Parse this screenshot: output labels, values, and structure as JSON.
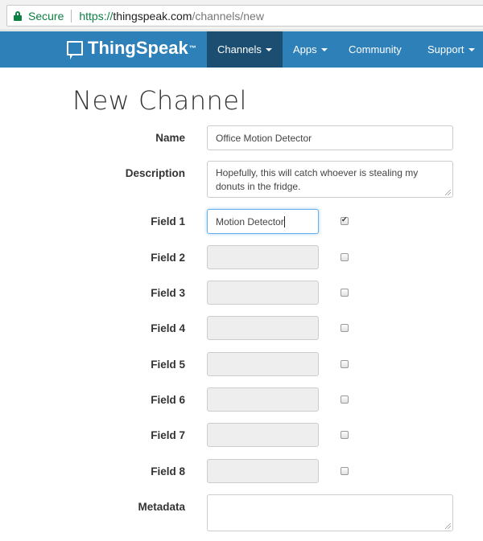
{
  "browser": {
    "secure_label": "Secure",
    "url_scheme": "https://",
    "url_host": "thingspeak.com",
    "url_path": "/channels/new"
  },
  "navbar": {
    "brand": "ThingSpeak",
    "brand_tm": "™",
    "items": [
      {
        "label": "Channels",
        "dropdown": true,
        "active": true
      },
      {
        "label": "Apps",
        "dropdown": true,
        "active": false
      },
      {
        "label": "Community",
        "dropdown": false,
        "active": false
      },
      {
        "label": "Support",
        "dropdown": true,
        "active": false
      }
    ],
    "color": "#2e80b9",
    "active_color": "#1c4e72"
  },
  "page": {
    "title": "New Channel"
  },
  "form": {
    "name_label": "Name",
    "name_value": "Office Motion Detector",
    "description_label": "Description",
    "description_value": "Hopefully, this will catch whoever is stealing my donuts in the fridge.",
    "fields": [
      {
        "label": "Field 1",
        "value": "Motion Detector",
        "checked": true
      },
      {
        "label": "Field 2",
        "value": "",
        "checked": false
      },
      {
        "label": "Field 3",
        "value": "",
        "checked": false
      },
      {
        "label": "Field 4",
        "value": "",
        "checked": false
      },
      {
        "label": "Field 5",
        "value": "",
        "checked": false
      },
      {
        "label": "Field 6",
        "value": "",
        "checked": false
      },
      {
        "label": "Field 7",
        "value": "",
        "checked": false
      },
      {
        "label": "Field 8",
        "value": "",
        "checked": false
      }
    ],
    "metadata_label": "Metadata",
    "metadata_value": ""
  }
}
